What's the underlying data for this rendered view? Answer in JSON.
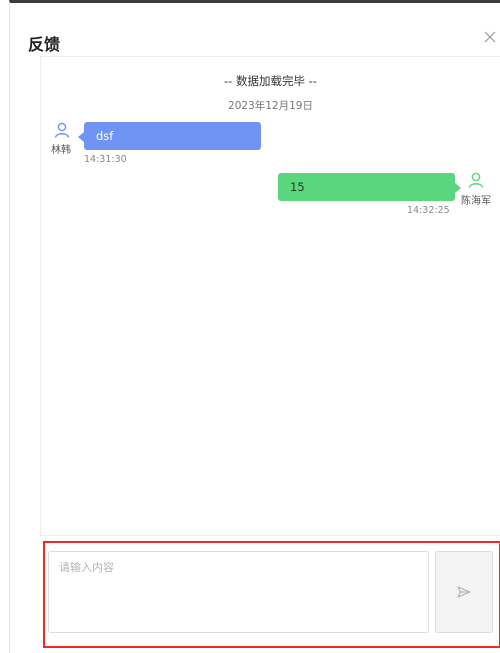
{
  "dialog": {
    "title": "反馈"
  },
  "chat": {
    "loaded_notice": "-- 数据加载完毕 --",
    "date": "2023年12月19日",
    "messages": [
      {
        "side": "left",
        "sender": "林韩",
        "text": "dsf",
        "time": "14:31:30",
        "avatar_icon": "user-icon",
        "color": "#6f94f4"
      },
      {
        "side": "right",
        "sender": "陈海军",
        "text": "15",
        "time": "14:32:25",
        "avatar_icon": "user-icon",
        "color": "#5ad67e"
      }
    ]
  },
  "composer": {
    "placeholder": "请输入内容",
    "value": "",
    "send_icon": "send-icon",
    "highlight_color": "#ee2b2b"
  },
  "icons": {
    "close": "close-icon"
  }
}
